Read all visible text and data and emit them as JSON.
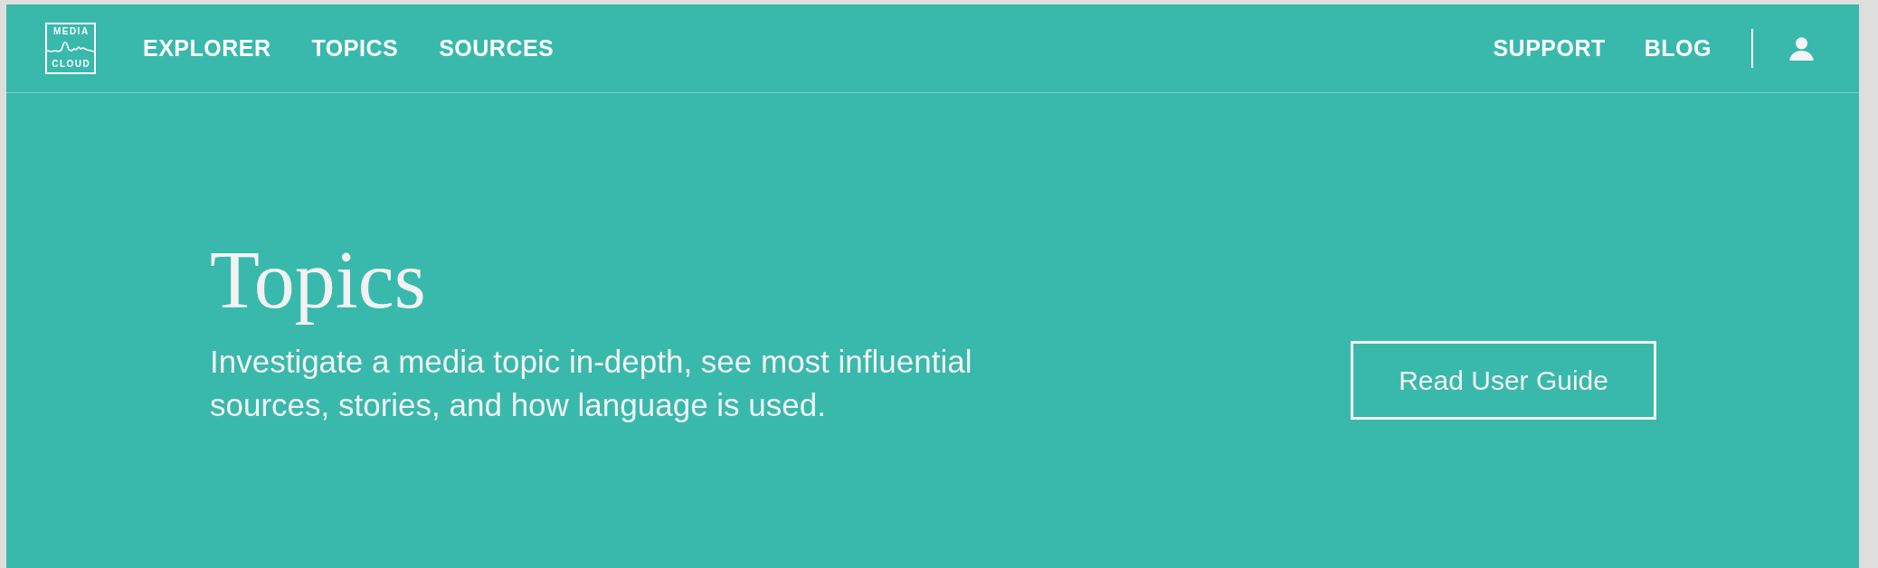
{
  "logo": {
    "top_text": "MEDIA",
    "bottom_text": "CLOUD"
  },
  "nav": {
    "left_items": [
      {
        "label": "EXPLORER"
      },
      {
        "label": "TOPICS"
      },
      {
        "label": "SOURCES"
      }
    ],
    "right_items": [
      {
        "label": "SUPPORT"
      },
      {
        "label": "BLOG"
      }
    ]
  },
  "hero": {
    "title": "Topics",
    "description": "Investigate a media topic in-depth, see most influential sources, stories, and how language is used.",
    "button": "Read User Guide"
  }
}
